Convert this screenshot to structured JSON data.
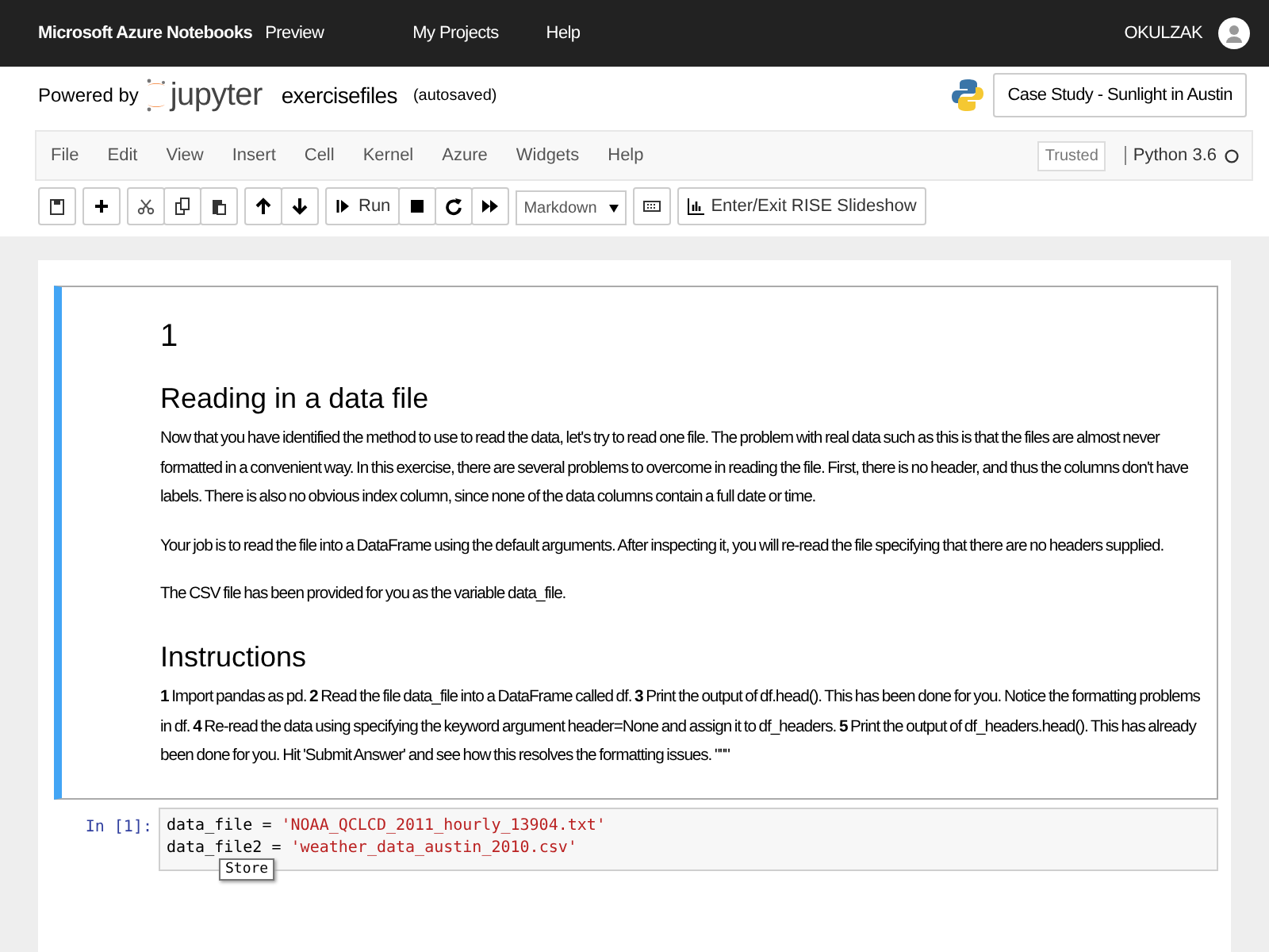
{
  "topbar": {
    "brand": "Microsoft Azure Notebooks",
    "tag": "Preview",
    "links": [
      "My Projects",
      "Help"
    ],
    "user": "OKULZAK"
  },
  "header": {
    "powered_by": "Powered by",
    "logo_text": "jupyter",
    "notebook_name": "exercisefiles",
    "save_status": "(autosaved)",
    "project_button": "Case Study - Sunlight in Austin"
  },
  "menu": {
    "items": [
      "File",
      "Edit",
      "View",
      "Insert",
      "Cell",
      "Kernel",
      "Azure",
      "Widgets",
      "Help"
    ],
    "trusted": "Trusted",
    "kernel": "Python 3.6"
  },
  "toolbar": {
    "run": "Run",
    "cell_type": "Markdown",
    "rise": "Enter/Exit RISE Slideshow"
  },
  "markdown_cell": {
    "selected": true,
    "heading": "1",
    "section": "Reading in a data file",
    "paragraphs": [
      "Now that you have identified the method to use to read the data, let's try to read one file. The problem with real data such as this is that the files are almost never formatted in a convenient way. In this exercise, there are several problems to overcome in reading the file. First, there is no header, and thus the columns don't have labels. There is also no obvious index column, since none of the data columns contain a full date or time.",
      "Your job is to read the file into a DataFrame using the default arguments. After inspecting it, you will re-read the file specifying that there are no headers supplied.",
      "The CSV file has been provided for you as the variable data_file."
    ],
    "instructions_heading": "Instructions",
    "instructions": "**1** Import pandas as pd. **2** Read the file data_file into a DataFrame called df. **3** Print the output of df.head(). This has been done for you. Notice the formatting problems in df. **4** Re-read the data using specifying the keyword argument header=None and assign it to df_headers. **5** Print the output of df_headers.head(). This has already been done for you. Hit 'Submit Answer' and see how this resolves the formatting issues. \"\"\""
  },
  "code_cell": {
    "prompt": "In [1]:",
    "lines": [
      {
        "code": "data_file = ",
        "string": "'NOAA_QCLCD_2011_hourly_13904.txt'"
      },
      {
        "code": "data_file2 = ",
        "string": "'weather_data_austin_2010.csv'"
      }
    ],
    "tooltip": "Store"
  }
}
